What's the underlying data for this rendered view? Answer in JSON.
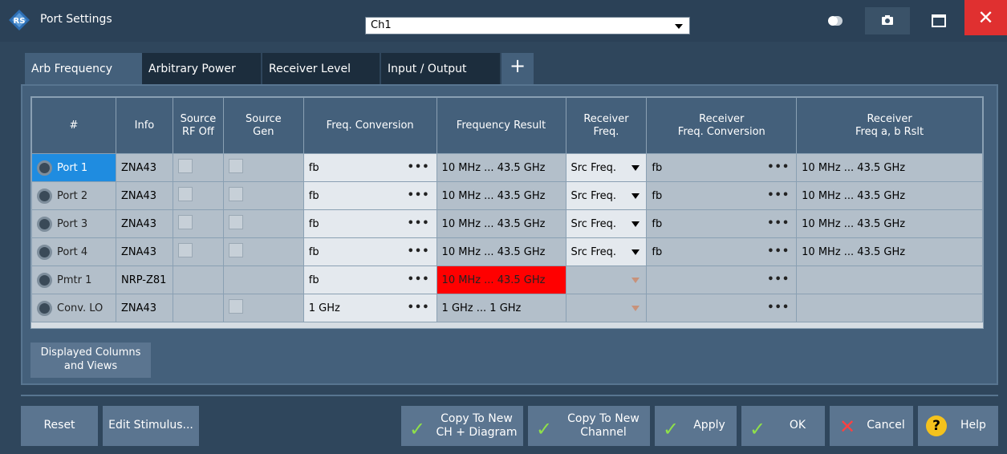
{
  "window": {
    "title": "Port Settings",
    "channel": "Ch1",
    "close_glyph": "✕"
  },
  "tabs": [
    {
      "label": "Arb Frequency"
    },
    {
      "label": "Arbitrary Power"
    },
    {
      "label": "Receiver Level"
    },
    {
      "label": "Input / Output"
    },
    {
      "label": "+"
    }
  ],
  "table": {
    "headers": [
      "#",
      "Info",
      "Source\nRF Off",
      "Source\nGen",
      "Freq. Conversion",
      "Frequency Result",
      "Receiver\nFreq.",
      "Receiver\nFreq. Conversion",
      "Receiver\nFreq a, b Rslt"
    ],
    "rows": [
      {
        "port": "Port 1",
        "info": "ZNA43",
        "freq_conv": "fb",
        "freq_result": "10 MHz ... 43.5 GHz",
        "rcv_freq": "Src Freq.",
        "rcv_conv": "fb",
        "rcv_result": "10 MHz ... 43.5 GHz"
      },
      {
        "port": "Port 2",
        "info": "ZNA43",
        "freq_conv": "fb",
        "freq_result": "10 MHz ... 43.5 GHz",
        "rcv_freq": "Src Freq.",
        "rcv_conv": "fb",
        "rcv_result": "10 MHz ... 43.5 GHz"
      },
      {
        "port": "Port 3",
        "info": "ZNA43",
        "freq_conv": "fb",
        "freq_result": "10 MHz ... 43.5 GHz",
        "rcv_freq": "Src Freq.",
        "rcv_conv": "fb",
        "rcv_result": "10 MHz ... 43.5 GHz"
      },
      {
        "port": "Port 4",
        "info": "ZNA43",
        "freq_conv": "fb",
        "freq_result": "10 MHz ... 43.5 GHz",
        "rcv_freq": "Src Freq.",
        "rcv_conv": "fb",
        "rcv_result": "10 MHz ... 43.5 GHz"
      },
      {
        "port": "Pmtr 1",
        "info": "NRP-Z81",
        "freq_conv": "fb",
        "freq_result": "10 MHz ... 43.5 GHz",
        "rcv_freq": "",
        "rcv_conv": "",
        "rcv_result": ""
      },
      {
        "port": "Conv. LO",
        "info": "ZNA43",
        "freq_conv": "1 GHz",
        "freq_result": "1 GHz ... 1 GHz",
        "rcv_freq": "",
        "rcv_conv": "",
        "rcv_result": ""
      }
    ],
    "ellipsis": "•••"
  },
  "displayed_columns_button": "Displayed Columns\nand Views",
  "buttons": {
    "reset": "Reset",
    "edit_stimulus": "Edit Stimulus...",
    "copy_new_ch_diagram": "Copy To New\nCH + Diagram",
    "copy_new_channel": "Copy To New\nChannel",
    "apply": "Apply",
    "ok": "OK",
    "cancel": "Cancel",
    "help": "Help",
    "check_glyph": "✓",
    "cancel_glyph": "✕",
    "help_glyph": "?"
  },
  "colors": {
    "background": "#2f465c",
    "accent": "#1f8ce0",
    "error": "#ff0000",
    "close": "#e03030"
  }
}
